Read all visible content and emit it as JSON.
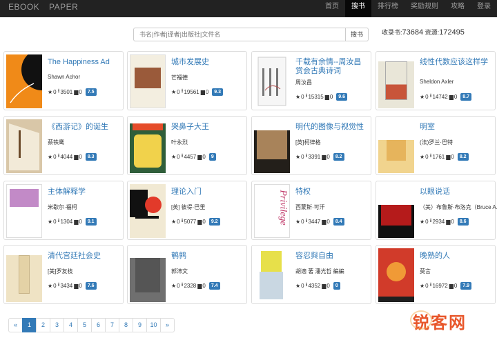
{
  "brand": {
    "left": "EBOOK",
    "right": "PAPER"
  },
  "nav": [
    "首页",
    "搜书",
    "排行榜",
    "奖励规则",
    "攻略",
    "登录"
  ],
  "search": {
    "placeholder": "书名|作者|译者|出版社|文件名",
    "button": "搜书"
  },
  "stats": {
    "books_label": "收录书:",
    "books": "73684",
    "resources_label": "资源:",
    "resources": "172495"
  },
  "books": [
    {
      "title": "The Happiness Ad",
      "author": "Shawn Achor",
      "stars": "0",
      "downloads": "3501",
      "comments": "0",
      "score": "7.5"
    },
    {
      "title": "城市发展史",
      "author": "芒福德",
      "stars": "0",
      "downloads": "19561",
      "comments": "0",
      "score": "9.3"
    },
    {
      "title": "千载有余情--周汝昌赏会古典诗词",
      "author": "周汝昌",
      "stars": "0",
      "downloads": "15315",
      "comments": "0",
      "score": "9.6"
    },
    {
      "title": "线性代数应该这样学",
      "author": "Sheldon Axler",
      "stars": "0",
      "downloads": "14742",
      "comments": "0",
      "score": "8.7"
    },
    {
      "title": "《西游记》的诞生",
      "author": "蔡铁鹰",
      "stars": "0",
      "downloads": "4044",
      "comments": "0",
      "score": "8.3"
    },
    {
      "title": "哭鼻子大王",
      "author": "叶永烈",
      "stars": "0",
      "downloads": "4457",
      "comments": "0",
      "score": "9"
    },
    {
      "title": "明代的图像与视觉性",
      "author": "[英]柯律格",
      "stars": "0",
      "downloads": "3391",
      "comments": "0",
      "score": "8.2"
    },
    {
      "title": "明室",
      "author": "(法)罗兰·巴特",
      "stars": "0",
      "downloads": "1761",
      "comments": "0",
      "score": "8.2"
    },
    {
      "title": "主体解释学",
      "author": "米歇尔·福柯",
      "stars": "0",
      "downloads": "1304",
      "comments": "0",
      "score": "9.1"
    },
    {
      "title": "理论入门",
      "author": "[英] 彼得·巴里",
      "stars": "0",
      "downloads": "5077",
      "comments": "0",
      "score": "9.2"
    },
    {
      "title": "特权",
      "author": "西蒙斯·可汗",
      "stars": "0",
      "downloads": "3447",
      "comments": "0",
      "score": "8.4"
    },
    {
      "title": "以眼说话",
      "author": "（美）布鲁斯·布洛克（Bruce A.",
      "stars": "0",
      "downloads": "2934",
      "comments": "0",
      "score": "8.6"
    },
    {
      "title": "清代宫廷社会史",
      "author": "[美]罗友枝",
      "stars": "0",
      "downloads": "3434",
      "comments": "0",
      "score": "7.6"
    },
    {
      "title": "鹌鹑",
      "author": "郭沛文",
      "stars": "0",
      "downloads": "2328",
      "comments": "0",
      "score": "7.4"
    },
    {
      "title": "容忍與自由",
      "author": "胡適 著 潘光哲 編編",
      "stars": "0",
      "downloads": "4352",
      "comments": "0",
      "score": "0"
    },
    {
      "title": "晚熟的人",
      "author": "莫言",
      "stars": "0",
      "downloads": "16972",
      "comments": "0",
      "score": "7.9"
    }
  ],
  "pager": [
    "«",
    "1",
    "2",
    "3",
    "4",
    "5",
    "6",
    "7",
    "8",
    "9",
    "10",
    "»"
  ],
  "watermark": "锐客网"
}
